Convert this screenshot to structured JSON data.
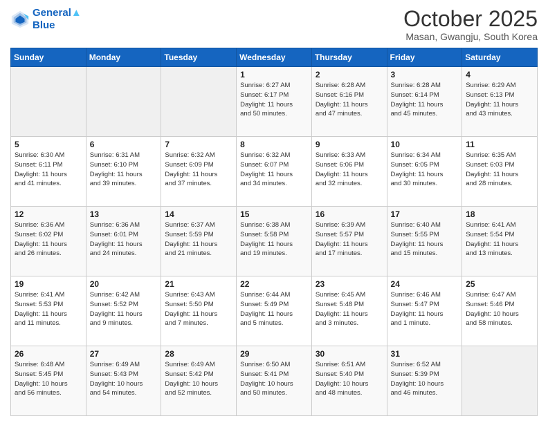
{
  "header": {
    "logo_line1": "General",
    "logo_line2": "Blue",
    "title": "October 2025",
    "subtitle": "Masan, Gwangju, South Korea"
  },
  "weekdays": [
    "Sunday",
    "Monday",
    "Tuesday",
    "Wednesday",
    "Thursday",
    "Friday",
    "Saturday"
  ],
  "weeks": [
    [
      {
        "day": "",
        "info": ""
      },
      {
        "day": "",
        "info": ""
      },
      {
        "day": "",
        "info": ""
      },
      {
        "day": "1",
        "info": "Sunrise: 6:27 AM\nSunset: 6:17 PM\nDaylight: 11 hours\nand 50 minutes."
      },
      {
        "day": "2",
        "info": "Sunrise: 6:28 AM\nSunset: 6:16 PM\nDaylight: 11 hours\nand 47 minutes."
      },
      {
        "day": "3",
        "info": "Sunrise: 6:28 AM\nSunset: 6:14 PM\nDaylight: 11 hours\nand 45 minutes."
      },
      {
        "day": "4",
        "info": "Sunrise: 6:29 AM\nSunset: 6:13 PM\nDaylight: 11 hours\nand 43 minutes."
      }
    ],
    [
      {
        "day": "5",
        "info": "Sunrise: 6:30 AM\nSunset: 6:11 PM\nDaylight: 11 hours\nand 41 minutes."
      },
      {
        "day": "6",
        "info": "Sunrise: 6:31 AM\nSunset: 6:10 PM\nDaylight: 11 hours\nand 39 minutes."
      },
      {
        "day": "7",
        "info": "Sunrise: 6:32 AM\nSunset: 6:09 PM\nDaylight: 11 hours\nand 37 minutes."
      },
      {
        "day": "8",
        "info": "Sunrise: 6:32 AM\nSunset: 6:07 PM\nDaylight: 11 hours\nand 34 minutes."
      },
      {
        "day": "9",
        "info": "Sunrise: 6:33 AM\nSunset: 6:06 PM\nDaylight: 11 hours\nand 32 minutes."
      },
      {
        "day": "10",
        "info": "Sunrise: 6:34 AM\nSunset: 6:05 PM\nDaylight: 11 hours\nand 30 minutes."
      },
      {
        "day": "11",
        "info": "Sunrise: 6:35 AM\nSunset: 6:03 PM\nDaylight: 11 hours\nand 28 minutes."
      }
    ],
    [
      {
        "day": "12",
        "info": "Sunrise: 6:36 AM\nSunset: 6:02 PM\nDaylight: 11 hours\nand 26 minutes."
      },
      {
        "day": "13",
        "info": "Sunrise: 6:36 AM\nSunset: 6:01 PM\nDaylight: 11 hours\nand 24 minutes."
      },
      {
        "day": "14",
        "info": "Sunrise: 6:37 AM\nSunset: 5:59 PM\nDaylight: 11 hours\nand 21 minutes."
      },
      {
        "day": "15",
        "info": "Sunrise: 6:38 AM\nSunset: 5:58 PM\nDaylight: 11 hours\nand 19 minutes."
      },
      {
        "day": "16",
        "info": "Sunrise: 6:39 AM\nSunset: 5:57 PM\nDaylight: 11 hours\nand 17 minutes."
      },
      {
        "day": "17",
        "info": "Sunrise: 6:40 AM\nSunset: 5:55 PM\nDaylight: 11 hours\nand 15 minutes."
      },
      {
        "day": "18",
        "info": "Sunrise: 6:41 AM\nSunset: 5:54 PM\nDaylight: 11 hours\nand 13 minutes."
      }
    ],
    [
      {
        "day": "19",
        "info": "Sunrise: 6:41 AM\nSunset: 5:53 PM\nDaylight: 11 hours\nand 11 minutes."
      },
      {
        "day": "20",
        "info": "Sunrise: 6:42 AM\nSunset: 5:52 PM\nDaylight: 11 hours\nand 9 minutes."
      },
      {
        "day": "21",
        "info": "Sunrise: 6:43 AM\nSunset: 5:50 PM\nDaylight: 11 hours\nand 7 minutes."
      },
      {
        "day": "22",
        "info": "Sunrise: 6:44 AM\nSunset: 5:49 PM\nDaylight: 11 hours\nand 5 minutes."
      },
      {
        "day": "23",
        "info": "Sunrise: 6:45 AM\nSunset: 5:48 PM\nDaylight: 11 hours\nand 3 minutes."
      },
      {
        "day": "24",
        "info": "Sunrise: 6:46 AM\nSunset: 5:47 PM\nDaylight: 11 hours\nand 1 minute."
      },
      {
        "day": "25",
        "info": "Sunrise: 6:47 AM\nSunset: 5:46 PM\nDaylight: 10 hours\nand 58 minutes."
      }
    ],
    [
      {
        "day": "26",
        "info": "Sunrise: 6:48 AM\nSunset: 5:45 PM\nDaylight: 10 hours\nand 56 minutes."
      },
      {
        "day": "27",
        "info": "Sunrise: 6:49 AM\nSunset: 5:43 PM\nDaylight: 10 hours\nand 54 minutes."
      },
      {
        "day": "28",
        "info": "Sunrise: 6:49 AM\nSunset: 5:42 PM\nDaylight: 10 hours\nand 52 minutes."
      },
      {
        "day": "29",
        "info": "Sunrise: 6:50 AM\nSunset: 5:41 PM\nDaylight: 10 hours\nand 50 minutes."
      },
      {
        "day": "30",
        "info": "Sunrise: 6:51 AM\nSunset: 5:40 PM\nDaylight: 10 hours\nand 48 minutes."
      },
      {
        "day": "31",
        "info": "Sunrise: 6:52 AM\nSunset: 5:39 PM\nDaylight: 10 hours\nand 46 minutes."
      },
      {
        "day": "",
        "info": ""
      }
    ]
  ]
}
